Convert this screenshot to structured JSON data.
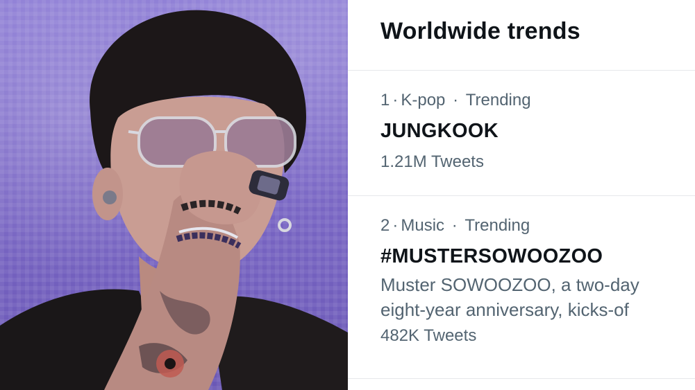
{
  "photo": {
    "subject": "performer-photo"
  },
  "panel": {
    "title": "Worldwide trends",
    "trends": [
      {
        "rank": "1",
        "category": "K-pop",
        "status": "Trending",
        "name": "JUNGKOOK",
        "tweets": "1.21M Tweets"
      },
      {
        "rank": "2",
        "category": "Music",
        "status": "Trending",
        "name": "#MUSTERSOWOOZOO",
        "description_lines": [
          "Muster SOWOOZOO, a two-day",
          "eight-year anniversary, kicks-of"
        ],
        "tweets": "482K Tweets"
      }
    ]
  },
  "colors": {
    "text_primary": "#0f1419",
    "text_secondary": "#536471",
    "divider": "#e6e8ea",
    "photo_background": "#7b68c6"
  }
}
